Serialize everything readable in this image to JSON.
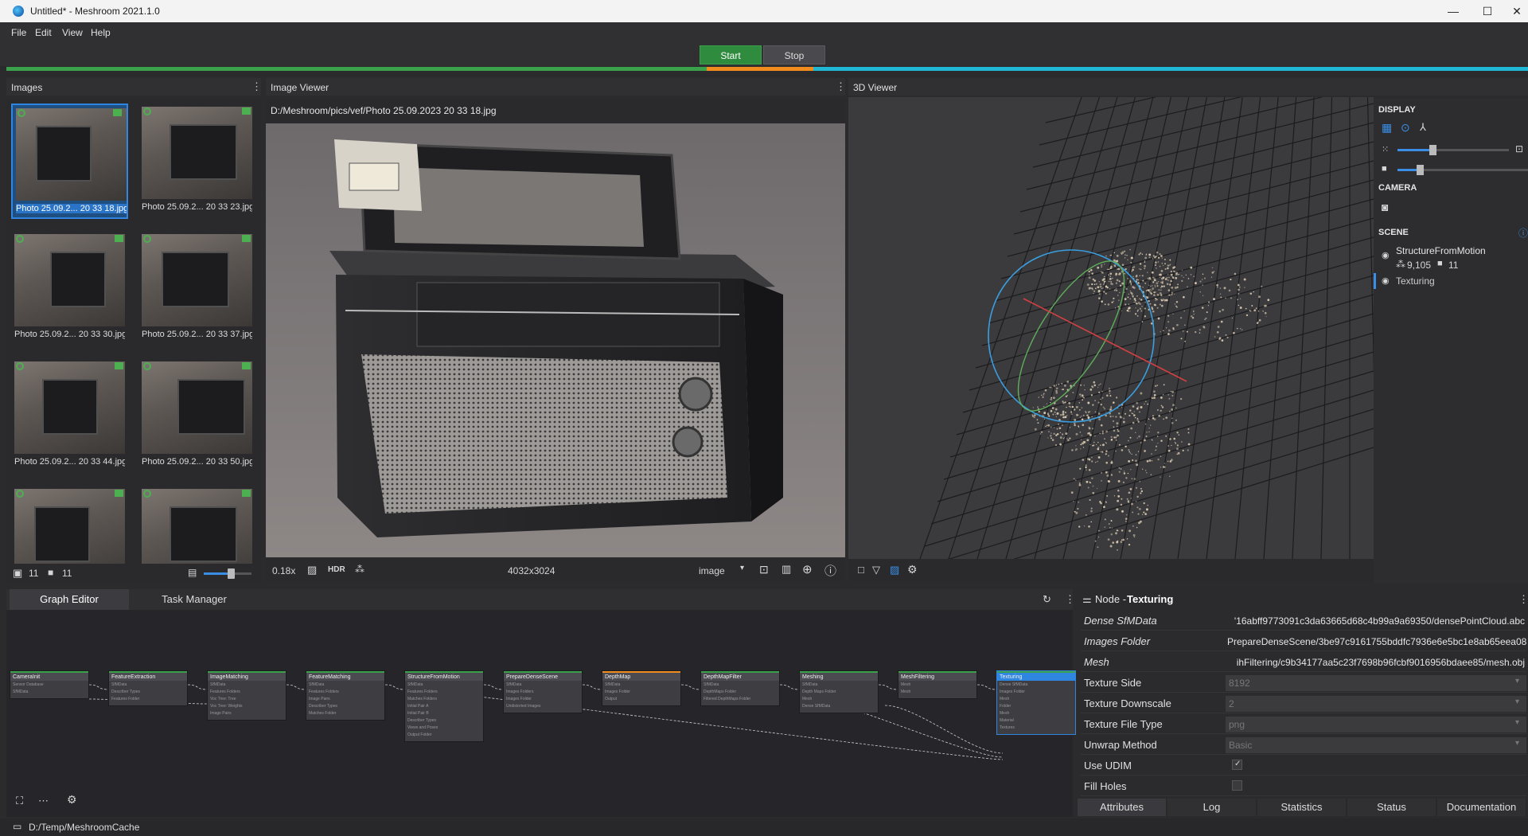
{
  "window": {
    "title": "Untitled* - Meshroom 2021.1.0",
    "controls": [
      "—",
      "☐",
      "✕"
    ]
  },
  "menu": [
    "File",
    "Edit",
    "View",
    "Help"
  ],
  "toolbar": {
    "start": "Start",
    "stop": "Stop"
  },
  "progress": {
    "done_fraction": 0.46,
    "running_fraction": 0.07,
    "colors": {
      "done": "#3aa14a",
      "running": "#f08c1e",
      "pending": "#1fb7d4"
    }
  },
  "images": {
    "title": "Images",
    "thumbs": [
      {
        "caption": "Photo 25.09.2... 20 33 18.jpg",
        "selected": true
      },
      {
        "caption": "Photo 25.09.2... 20 33 23.jpg"
      },
      {
        "caption": "Photo 25.09.2... 20 33 30.jpg"
      },
      {
        "caption": "Photo 25.09.2... 20 33 37.jpg"
      },
      {
        "caption": "Photo 25.09.2... 20 33 44.jpg"
      },
      {
        "caption": "Photo 25.09.2... 20 33 50.jpg"
      },
      {
        "caption": ""
      },
      {
        "caption": ""
      }
    ],
    "image_count": "11",
    "camera_count": "11"
  },
  "image_viewer": {
    "title": "Image Viewer",
    "path": "D:/Meshroom/pics/vef/Photo 25.09.2023 20 33 18.jpg",
    "zoom": "0.18x",
    "hdr": "HDR",
    "resolution": "4032x3024",
    "mode": "image"
  },
  "viewer3d": {
    "title": "3D Viewer",
    "display": "DISPLAY",
    "camera": "CAMERA",
    "scene": "SCENE",
    "scene_items": [
      {
        "name": "StructureFromMotion",
        "points": "9,105",
        "cameras": "11"
      },
      {
        "name": "Texturing"
      }
    ]
  },
  "graph": {
    "tabs": [
      "Graph Editor",
      "Task Manager"
    ],
    "nodes": [
      {
        "name": "CameraInit",
        "ports": [
          "Sensor Database",
          "SfMData"
        ]
      },
      {
        "name": "FeatureExtraction",
        "ports": [
          "SfMData",
          "Describer Types",
          "Features Folder"
        ]
      },
      {
        "name": "ImageMatching",
        "ports": [
          "SfMData",
          "Features Folders",
          "Voc Tree: Tree",
          "Voc Tree: Weights",
          "Image Pairs"
        ]
      },
      {
        "name": "FeatureMatching",
        "ports": [
          "SfMData",
          "Features Folders",
          "Image Pairs",
          "Describer Types",
          "Matches Folder"
        ]
      },
      {
        "name": "StructureFromMotion",
        "ports": [
          "SfMData",
          "Features Folders",
          "Matches Folders",
          "Initial Pair A",
          "Initial Pair B",
          "Describer Types",
          "Views and Poses",
          "Output Folder"
        ]
      },
      {
        "name": "PrepareDenseScene",
        "ports": [
          "SfMData",
          "Images Folders",
          "Images Folder",
          "Undistorted Images"
        ]
      },
      {
        "name": "DepthMap",
        "ports": [
          "SfMData",
          "Images Folder",
          "Output"
        ]
      },
      {
        "name": "DepthMapFilter",
        "ports": [
          "SfMData",
          "DepthMaps Folder",
          "Filtered DepthMaps Folder"
        ]
      },
      {
        "name": "Meshing",
        "ports": [
          "SfMData",
          "Depth Maps Folder",
          "Mesh",
          "Dense SfMData"
        ]
      },
      {
        "name": "MeshFiltering",
        "ports": [
          "Mesh",
          "Mesh"
        ]
      },
      {
        "name": "Texturing",
        "ports": [
          "Dense SfMData",
          "Images Folder",
          "Mesh",
          "Folder",
          "Mesh",
          "Material",
          "Textures"
        ]
      }
    ]
  },
  "node_panel": {
    "prefix": "Node - ",
    "name": "Texturing",
    "rows": [
      {
        "key": "Dense SfMData",
        "value": "'16abff9773091c3da63665d68c4b99a9a69350/densePointCloud.abc",
        "italic": true
      },
      {
        "key": "Images Folder",
        "value": "PrepareDenseScene/3be97c9161755bddfc7936e6e5bc1e8ab65eea08",
        "italic": true
      },
      {
        "key": "Mesh",
        "value": "ihFiltering/c9b34177aa5c23f7698b96fcbf9016956bdaee85/mesh.obj",
        "italic": true
      },
      {
        "key": "Texture Side",
        "value": "8192",
        "disabled": true
      },
      {
        "key": "Texture Downscale",
        "value": "2",
        "disabled": true
      },
      {
        "key": "Texture File Type",
        "value": "png",
        "disabled": true
      },
      {
        "key": "Unwrap Method",
        "value": "Basic",
        "disabled": true
      },
      {
        "key": "Use UDIM",
        "value": "✓",
        "checkbox": true
      },
      {
        "key": "Fill Holes",
        "value": "",
        "checkbox": true
      }
    ],
    "tabs": [
      "Attributes",
      "Log",
      "Statistics",
      "Status",
      "Documentation"
    ]
  },
  "status": {
    "cache": "D:/Temp/MeshroomCache"
  }
}
